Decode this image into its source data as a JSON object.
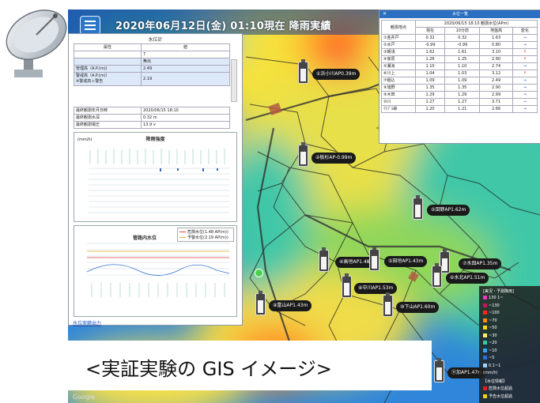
{
  "header": {
    "title": "2020年06月12日(金) 01:10現在 降雨実績"
  },
  "left_panel": {
    "title": "水位計",
    "table_header": [
      "属性",
      "値"
    ],
    "rows": [
      {
        "label": "",
        "value": "7"
      },
      {
        "label": "",
        "value": "無出"
      },
      {
        "label": "管理高（A.P.(m))",
        "value": "2.49"
      },
      {
        "label": "警戒高（A.P.(m)）\n※警戒高＋警告",
        "value": "2.19"
      },
      {
        "label": "最終観測年月日時",
        "value": "2020/06/15 18:10"
      },
      {
        "label": "最終観測水深",
        "value": "0.32 m"
      },
      {
        "label": "最終観測電圧",
        "value": "13.9 v"
      }
    ],
    "rain_chart_title": "降雨強度",
    "rain_chart_unit": "(mm/h)",
    "level_chart_title": "管路内水位",
    "level_legend": [
      "危険水位(1.48 AP(m))",
      "予警水位(2.19 AP(m))"
    ],
    "download_link": "水位実績出力"
  },
  "right_panel": {
    "title": "水位一覧",
    "timestamp": "2020/06/15 18:10 観測水位(APm)",
    "columns": [
      "観測地点",
      "現在",
      "10分前",
      "地盤高",
      "変化"
    ],
    "rows": [
      {
        "name": "①金井戸",
        "now": "0.32",
        "prev": "0.32",
        "ground": "1.63",
        "change": "→"
      },
      {
        "name": "②水戸",
        "now": "-0.99",
        "prev": "-0.99",
        "ground": "0.80",
        "change": "→"
      },
      {
        "name": "③朝浅",
        "now": "1.62",
        "prev": "1.61",
        "ground": "3.10",
        "change": "↑"
      },
      {
        "name": "④家原",
        "now": "1.26",
        "prev": "1.25",
        "ground": "2.90",
        "change": "↑"
      },
      {
        "name": "⑤瀬滝",
        "now": "1.10",
        "prev": "1.10",
        "ground": "2.74",
        "change": "→"
      },
      {
        "name": "⑥川上",
        "now": "1.04",
        "prev": "1.03",
        "ground": "3.12",
        "change": "↑"
      },
      {
        "name": "⑦稲込",
        "now": "1.09",
        "prev": "1.09",
        "ground": "2.49",
        "change": "→"
      },
      {
        "name": "⑧旭野",
        "now": "1.35",
        "prev": "1.35",
        "ground": "2.90",
        "change": "→"
      },
      {
        "name": "⑨木田",
        "now": "1.29",
        "prev": "1.29",
        "ground": "2.99",
        "change": "→"
      },
      {
        "name": "⑩川",
        "now": "1.27",
        "prev": "1.27",
        "ground": "3.71",
        "change": "→"
      },
      {
        "name": "⑪ﾌﾟﾙ鉢",
        "now": "1.20",
        "prev": "1.21",
        "ground": "2.66",
        "change": "→"
      }
    ]
  },
  "markers": [
    {
      "label": "①浜小川AP0.39m"
    },
    {
      "label": "②板杉AP-0.99m"
    },
    {
      "label": "⑤田野AP1.62m"
    },
    {
      "label": "④高垣AP1.48m"
    },
    {
      "label": "⑤田垣AP1.43m"
    },
    {
      "label": "⑦水田AP1.35m"
    },
    {
      "label": "⑥水北AP1.51m"
    },
    {
      "label": "⑧中川AP1.53m"
    },
    {
      "label": "⑨富山AP1.43m"
    },
    {
      "label": "⑩下山AP1.60m"
    },
    {
      "label": "⑪加AP1.47m"
    }
  ],
  "legend": {
    "title": "[実況・予測降雨]",
    "items": [
      {
        "label": "130 1~",
        "color": "#e23bc9"
      },
      {
        "label": "~130",
        "color": "#c0185a"
      },
      {
        "label": "~100",
        "color": "#ff2a20"
      },
      {
        "label": "~70",
        "color": "#ff8a1a"
      },
      {
        "label": "~50",
        "color": "#f7d61c"
      },
      {
        "label": "~30",
        "color": "#fff06a"
      },
      {
        "label": "~20",
        "color": "#35c9a8"
      },
      {
        "label": "~10",
        "color": "#3aa4f0"
      },
      {
        "label": "~5",
        "color": "#2a6fd6"
      },
      {
        "label": "0.1~1",
        "color": "#9bd0ff"
      },
      {
        "label": "(mm/h)",
        "color": ""
      },
      {
        "label": "【水位情報】",
        "color": ""
      },
      {
        "label": "危険水位超過",
        "color": "#e02020"
      },
      {
        "label": "予告水位超過",
        "color": "#f0d020"
      }
    ]
  },
  "caption": "<実証実験の GIS イメージ>",
  "footer": "Google"
}
